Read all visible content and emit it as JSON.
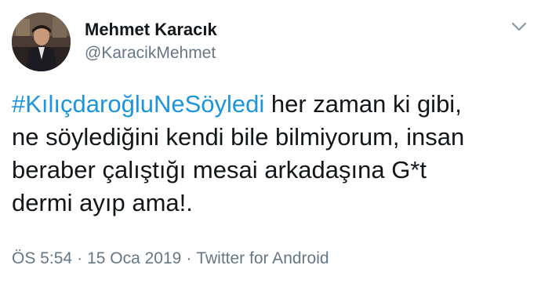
{
  "author": {
    "display_name": "Mehmet Karacık",
    "handle": "@KaracikMehmet"
  },
  "icons": {
    "avatar": "profile-photo",
    "menu": "chevron-down-icon"
  },
  "colors": {
    "link": "#1b95e0",
    "text": "#14171a",
    "secondary": "#657786"
  },
  "tweet": {
    "hashtag": "#KılıçdaroğluNeSöyledi",
    "text_line1_rest": " her zaman ki gibi,",
    "text_line2": "ne söylediğini kendi bile bilmiyorum, insan",
    "text_line3": "beraber çalıştığı mesai arkadaşına G*t",
    "text_line4": "dermi ayıp ama!."
  },
  "meta": {
    "time": "ÖS 5:54",
    "separator": "·",
    "date": "15 Oca 2019",
    "source": "Twitter for Android"
  }
}
